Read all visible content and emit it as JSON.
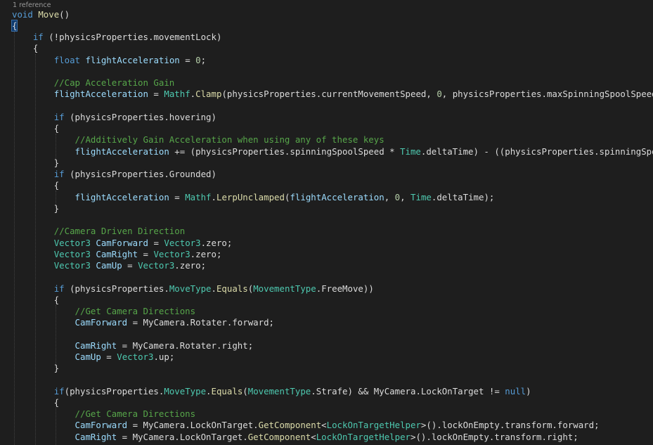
{
  "editor": {
    "codelens": "1 reference",
    "lines": [
      [
        {
          "t": "void",
          "c": "kw"
        },
        {
          "t": " "
        },
        {
          "t": "Move",
          "c": "fn"
        },
        {
          "t": "()"
        }
      ],
      [
        {
          "t": "{",
          "c": "brace-match"
        }
      ],
      [
        {
          "t": "    "
        },
        {
          "t": "if",
          "c": "kw"
        },
        {
          "t": " (!"
        },
        {
          "t": "physicsProperties"
        },
        {
          "t": "."
        },
        {
          "t": "movementLock"
        },
        {
          "t": ")"
        }
      ],
      [
        {
          "t": "    {"
        }
      ],
      [
        {
          "t": "        "
        },
        {
          "t": "float",
          "c": "kw"
        },
        {
          "t": " "
        },
        {
          "t": "flightAcceleration",
          "c": "mb"
        },
        {
          "t": " = "
        },
        {
          "t": "0",
          "c": "nu"
        },
        {
          "t": ";"
        }
      ],
      [
        {
          "t": ""
        }
      ],
      [
        {
          "t": "        "
        },
        {
          "t": "//Cap Acceleration Gain",
          "c": "cm"
        }
      ],
      [
        {
          "t": "        "
        },
        {
          "t": "flightAcceleration",
          "c": "mb"
        },
        {
          "t": " = "
        },
        {
          "t": "Mathf",
          "c": "ty"
        },
        {
          "t": "."
        },
        {
          "t": "Clamp",
          "c": "fn"
        },
        {
          "t": "(physicsProperties.currentMovementSpeed, "
        },
        {
          "t": "0",
          "c": "nu"
        },
        {
          "t": ", physicsProperties.maxSpinningSpoolSpeed);"
        }
      ],
      [
        {
          "t": ""
        }
      ],
      [
        {
          "t": "        "
        },
        {
          "t": "if",
          "c": "kw"
        },
        {
          "t": " (physicsProperties.hovering)"
        }
      ],
      [
        {
          "t": "        {"
        }
      ],
      [
        {
          "t": "            "
        },
        {
          "t": "//Additively Gain Acceleration when using any of these keys",
          "c": "cm"
        }
      ],
      [
        {
          "t": "            "
        },
        {
          "t": "flightAcceleration",
          "c": "mb"
        },
        {
          "t": " += (physicsProperties.spinningSpoolSpeed * "
        },
        {
          "t": "Time",
          "c": "ty"
        },
        {
          "t": ".deltaTime) - ((physicsProperties.spinningSpoolS"
        }
      ],
      [
        {
          "t": "        }"
        }
      ],
      [
        {
          "t": "        "
        },
        {
          "t": "if",
          "c": "kw"
        },
        {
          "t": " (physicsProperties.Grounded)"
        }
      ],
      [
        {
          "t": "        {"
        }
      ],
      [
        {
          "t": "            "
        },
        {
          "t": "flightAcceleration",
          "c": "mb"
        },
        {
          "t": " = "
        },
        {
          "t": "Mathf",
          "c": "ty"
        },
        {
          "t": "."
        },
        {
          "t": "LerpUnclamped",
          "c": "fn"
        },
        {
          "t": "("
        },
        {
          "t": "flightAcceleration",
          "c": "mb"
        },
        {
          "t": ", "
        },
        {
          "t": "0",
          "c": "nu"
        },
        {
          "t": ", "
        },
        {
          "t": "Time",
          "c": "ty"
        },
        {
          "t": ".deltaTime);"
        }
      ],
      [
        {
          "t": "        }"
        }
      ],
      [
        {
          "t": ""
        }
      ],
      [
        {
          "t": "        "
        },
        {
          "t": "//Camera Driven Direction",
          "c": "cm"
        }
      ],
      [
        {
          "t": "        "
        },
        {
          "t": "Vector3",
          "c": "ty"
        },
        {
          "t": " "
        },
        {
          "t": "CamForward",
          "c": "mb"
        },
        {
          "t": " = "
        },
        {
          "t": "Vector3",
          "c": "ty"
        },
        {
          "t": ".zero;"
        }
      ],
      [
        {
          "t": "        "
        },
        {
          "t": "Vector3",
          "c": "ty"
        },
        {
          "t": " "
        },
        {
          "t": "CamRight",
          "c": "mb"
        },
        {
          "t": " = "
        },
        {
          "t": "Vector3",
          "c": "ty"
        },
        {
          "t": ".zero;"
        }
      ],
      [
        {
          "t": "        "
        },
        {
          "t": "Vector3",
          "c": "ty"
        },
        {
          "t": " "
        },
        {
          "t": "CamUp",
          "c": "mb"
        },
        {
          "t": " = "
        },
        {
          "t": "Vector3",
          "c": "ty"
        },
        {
          "t": ".zero;"
        }
      ],
      [
        {
          "t": ""
        }
      ],
      [
        {
          "t": "        "
        },
        {
          "t": "if",
          "c": "kw"
        },
        {
          "t": " (physicsProperties."
        },
        {
          "t": "MoveType",
          "c": "ty"
        },
        {
          "t": "."
        },
        {
          "t": "Equals",
          "c": "fn"
        },
        {
          "t": "("
        },
        {
          "t": "MovementType",
          "c": "ty"
        },
        {
          "t": ".FreeMove))"
        }
      ],
      [
        {
          "t": "        {"
        }
      ],
      [
        {
          "t": "            "
        },
        {
          "t": "//Get Camera Directions",
          "c": "cm"
        }
      ],
      [
        {
          "t": "            "
        },
        {
          "t": "CamForward",
          "c": "mb"
        },
        {
          "t": " = MyCamera.Rotater.forward;"
        }
      ],
      [
        {
          "t": ""
        }
      ],
      [
        {
          "t": "            "
        },
        {
          "t": "CamRight",
          "c": "mb"
        },
        {
          "t": " = MyCamera.Rotater.right;"
        }
      ],
      [
        {
          "t": "            "
        },
        {
          "t": "CamUp",
          "c": "mb"
        },
        {
          "t": " = "
        },
        {
          "t": "Vector3",
          "c": "ty"
        },
        {
          "t": ".up;"
        }
      ],
      [
        {
          "t": "        }"
        }
      ],
      [
        {
          "t": ""
        }
      ],
      [
        {
          "t": "        "
        },
        {
          "t": "if",
          "c": "kw"
        },
        {
          "t": "(physicsProperties."
        },
        {
          "t": "MoveType",
          "c": "ty"
        },
        {
          "t": "."
        },
        {
          "t": "Equals",
          "c": "fn"
        },
        {
          "t": "("
        },
        {
          "t": "MovementType",
          "c": "ty"
        },
        {
          "t": ".Strafe) && MyCamera.LockOnTarget != "
        },
        {
          "t": "null",
          "c": "kw"
        },
        {
          "t": ")"
        }
      ],
      [
        {
          "t": "        {"
        }
      ],
      [
        {
          "t": "            "
        },
        {
          "t": "//Get Camera Directions",
          "c": "cm"
        }
      ],
      [
        {
          "t": "            "
        },
        {
          "t": "CamForward",
          "c": "mb"
        },
        {
          "t": " = MyCamera.LockOnTarget."
        },
        {
          "t": "GetComponent",
          "c": "fn"
        },
        {
          "t": "<"
        },
        {
          "t": "LockOnTargetHelper",
          "c": "ty"
        },
        {
          "t": ">().lockOnEmpty.transform.forward;"
        }
      ],
      [
        {
          "t": "            "
        },
        {
          "t": "CamRight",
          "c": "mb"
        },
        {
          "t": " = MyCamera.LockOnTarget."
        },
        {
          "t": "GetComponent",
          "c": "fn"
        },
        {
          "t": "<"
        },
        {
          "t": "LockOnTargetHelper",
          "c": "ty"
        },
        {
          "t": ">().lockOnEmpty.transform.right;"
        }
      ]
    ]
  }
}
